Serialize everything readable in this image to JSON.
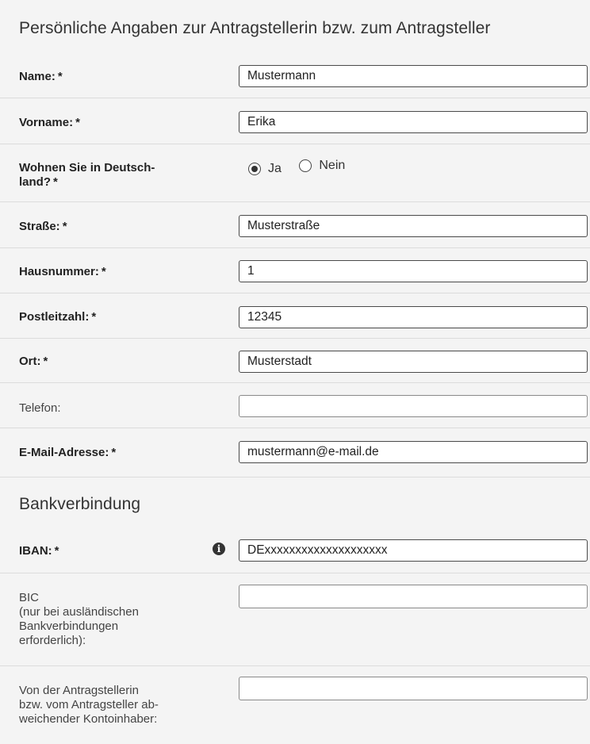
{
  "section_personal": {
    "title": "Persönliche Angaben zur Antragstellerin bzw. zum Antragsteller"
  },
  "required_marker": "*",
  "fields": {
    "name": {
      "label": "Name:",
      "value": "Mustermann"
    },
    "vorname": {
      "label": "Vorname:",
      "value": "Erika"
    },
    "wohnen": {
      "label_line1": "Wohnen Sie in Deutsch-",
      "label_line2": "land?",
      "options": [
        {
          "label": "Ja",
          "selected": true
        },
        {
          "label": "Nein",
          "selected": false
        }
      ]
    },
    "strasse": {
      "label": "Straße:",
      "value": "Musterstraße"
    },
    "hausnummer": {
      "label": "Hausnummer:",
      "value": "1"
    },
    "plz": {
      "label": "Postleitzahl:",
      "value": "12345"
    },
    "ort": {
      "label": "Ort:",
      "value": "Musterstadt"
    },
    "telefon": {
      "label": "Telefon:",
      "value": ""
    },
    "email": {
      "label": "E-Mail-Adresse:",
      "value": "mustermann@e-mail.de"
    }
  },
  "section_bank": {
    "title": "Bankverbindung"
  },
  "bank": {
    "iban": {
      "label": "IBAN:",
      "value": "DExxxxxxxxxxxxxxxxxxxx",
      "icon": "info-icon"
    },
    "bic": {
      "label_lines": [
        "BIC",
        "(nur bei ausländischen",
        "Bankverbindungen",
        "erforderlich):"
      ],
      "value": ""
    },
    "kontoinhaber": {
      "label_lines": [
        "Von der Antragstellerin",
        "bzw. vom Antragsteller ab-",
        "weichender Kontoinhaber:"
      ],
      "value": ""
    }
  }
}
